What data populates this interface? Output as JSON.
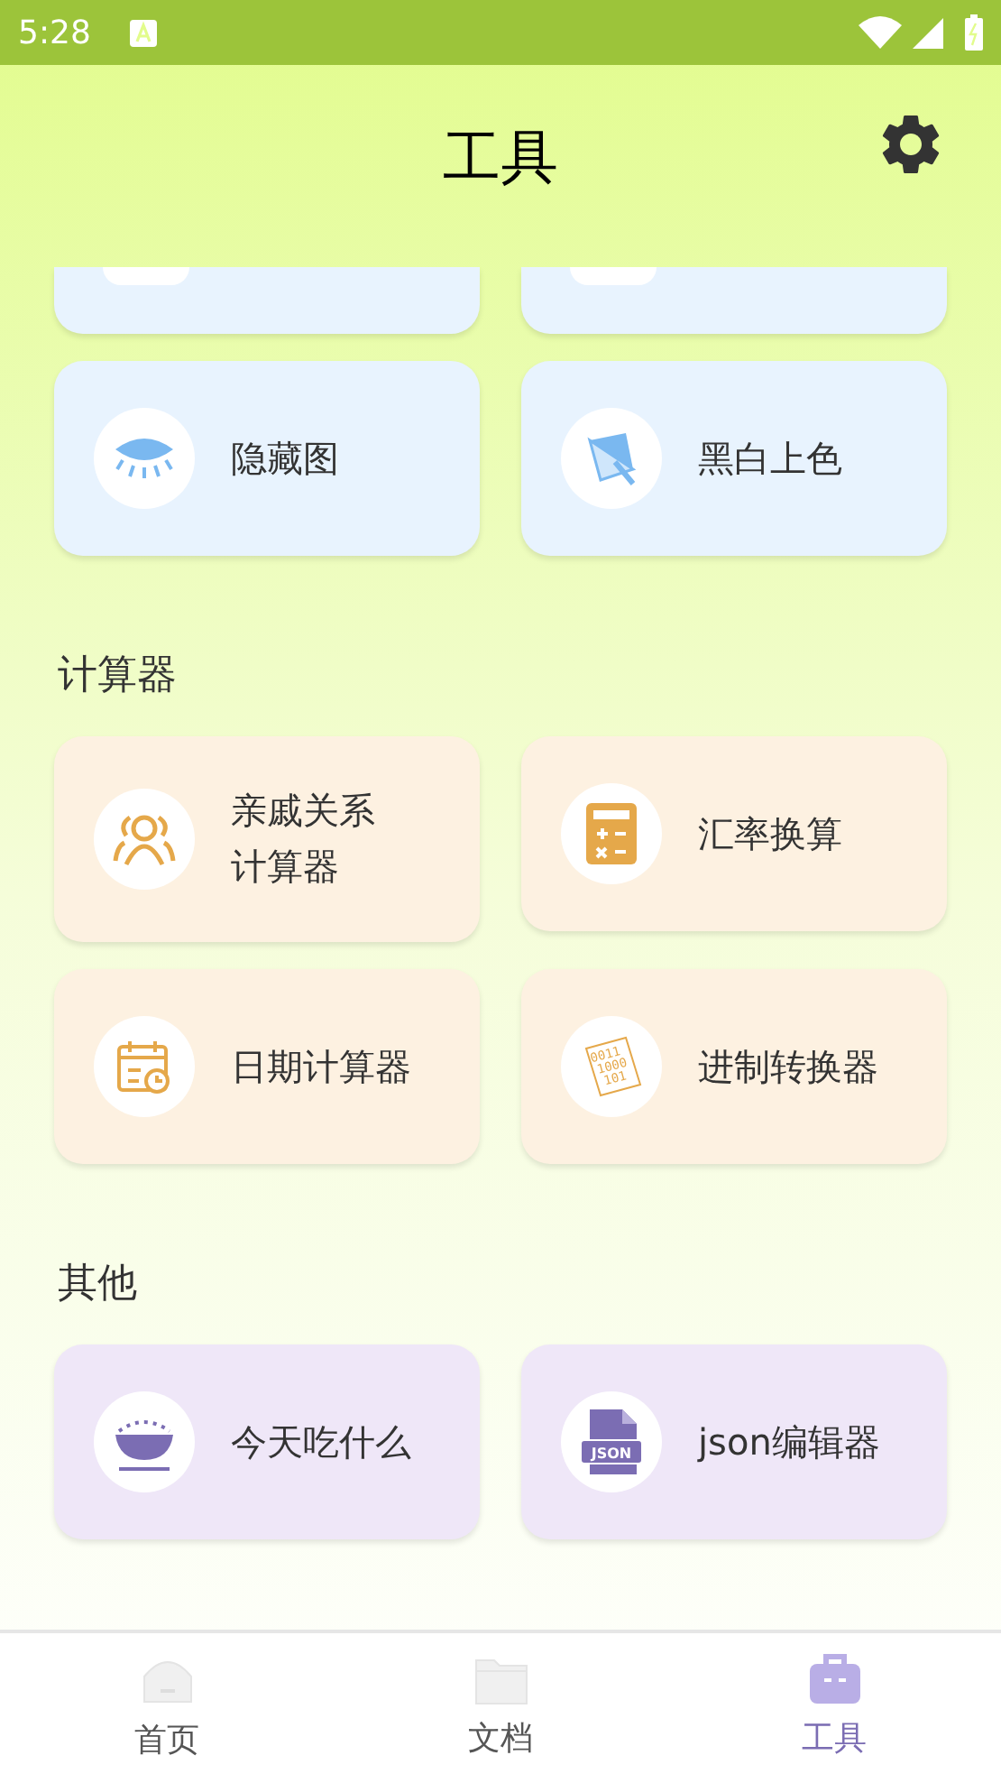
{
  "status_bar": {
    "time": "5:28"
  },
  "header": {
    "title": "工具"
  },
  "sections": [
    {
      "color": "#e8f3fe",
      "items": [
        {
          "kind": "cut"
        },
        {
          "kind": "cut"
        },
        {
          "kind": "eye",
          "label": "隐藏图"
        },
        {
          "kind": "paint",
          "label": "黑白上色"
        }
      ]
    },
    {
      "title": "计算器",
      "color": "#fdf1e1",
      "items": [
        {
          "kind": "people",
          "lines": [
            "亲戚关系",
            "计算器"
          ]
        },
        {
          "kind": "calculator",
          "label": "汇率换算"
        },
        {
          "kind": "calendar",
          "label": "日期计算器"
        },
        {
          "kind": "binary",
          "label": "进制转换器",
          "icon_lines": [
            "0011",
            "1000",
            "101"
          ]
        }
      ]
    },
    {
      "title": "其他",
      "color": "#efe7f8",
      "items": [
        {
          "kind": "bowl",
          "label": "今天吃什么"
        },
        {
          "kind": "json",
          "label": "json编辑器",
          "icon_text": "JSON"
        }
      ]
    }
  ],
  "nav": [
    {
      "kind": "home",
      "label": "首页",
      "selected": false
    },
    {
      "kind": "folder",
      "label": "文档",
      "selected": false
    },
    {
      "kind": "toolbox",
      "label": "工具",
      "selected": true
    }
  ]
}
